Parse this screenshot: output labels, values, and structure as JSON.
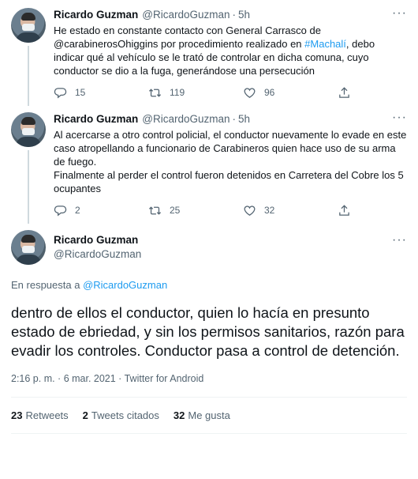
{
  "tweets": [
    {
      "name": "Ricardo Guzman",
      "handle": "@RicardoGuzman",
      "time": "5h",
      "text_before": "He estado en constante contacto con General Carrasco de @carabinerosOhiggins por procedimiento realizado en ",
      "hashtag": "#Machalí",
      "text_after": ", debo indicar qué al vehículo se le trató de controlar en dicha comuna, cuyo conductor se dio a la fuga, generándose una persecución",
      "replies": "15",
      "retweets": "119",
      "likes": "96"
    },
    {
      "name": "Ricardo Guzman",
      "handle": "@RicardoGuzman",
      "time": "5h",
      "text": "Al acercarse a otro control policial, el conductor nuevamente lo evade en este caso atropellando a funcionario de Carabineros quien hace uso de su arma de fuego.\nFinalmente al perder el control fueron detenidos en Carretera del Cobre los 5 ocupantes",
      "replies": "2",
      "retweets": "25",
      "likes": "32"
    }
  ],
  "main_tweet": {
    "name": "Ricardo Guzman",
    "handle": "@RicardoGuzman",
    "reply_prefix": "En respuesta a ",
    "reply_handle": "@RicardoGuzman",
    "text": "dentro de ellos el conductor, quien lo hacía en presunto estado de ebriedad, y sin los permisos sanitarios, razón para evadir los controles. Conductor pasa a control de detención.",
    "meta": "2:16 p. m. · 6 mar. 2021 · Twitter for Android",
    "retweets_count": "23",
    "retweets_label": "Retweets",
    "quotes_count": "2",
    "quotes_label": "Tweets citados",
    "likes_count": "32",
    "likes_label": "Me gusta"
  },
  "dot": "·",
  "more": "···",
  "colors": {
    "accent": "#1d9bf0",
    "secondary": "#536471",
    "line": "#cfd9de"
  },
  "icons": [
    "reply-icon",
    "retweet-icon",
    "like-icon",
    "share-icon",
    "more-icon"
  ]
}
